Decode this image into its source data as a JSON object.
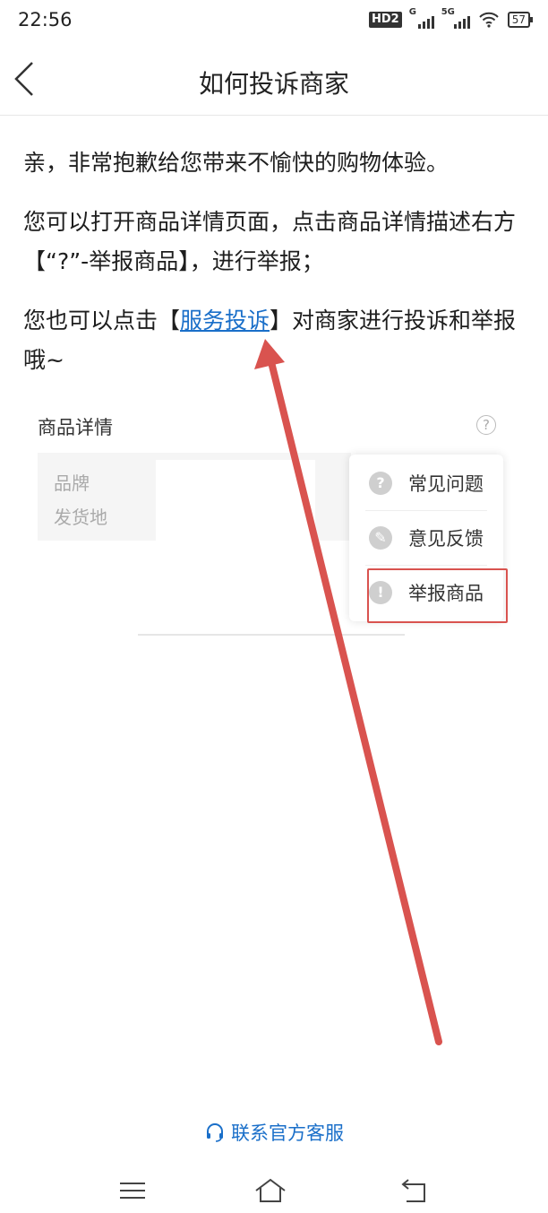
{
  "status_bar": {
    "time": "22:56",
    "hd": "HD2",
    "signal1": "G",
    "signal2": "5G",
    "battery": "57"
  },
  "nav": {
    "title": "如何投诉商家"
  },
  "content": {
    "p1": "亲，非常抱歉给您带来不愉快的购物体验。",
    "p2": "您可以打开商品详情页面，点击商品详情描述右方【“?”-举报商品】，进行举报；",
    "p3_before": "您也可以点击【",
    "p3_link": "服务投诉",
    "p3_after": "】对商家进行投诉和举报哦~"
  },
  "illustration": {
    "title": "商品详情",
    "spec_brand": "品牌",
    "spec_origin": "发货地",
    "menu_items": [
      {
        "label": "常见问题",
        "icon": "question-icon"
      },
      {
        "label": "意见反馈",
        "icon": "edit-icon"
      },
      {
        "label": "举报商品",
        "icon": "shield-icon"
      }
    ],
    "highlight_color": "#d9534f",
    "arrow_color": "#d9534f"
  },
  "footer": {
    "contact_label": "联系官方客服",
    "contact_icon": "headset-icon"
  },
  "colors": {
    "link": "#1a6fc9",
    "text": "#1e1e1e"
  }
}
